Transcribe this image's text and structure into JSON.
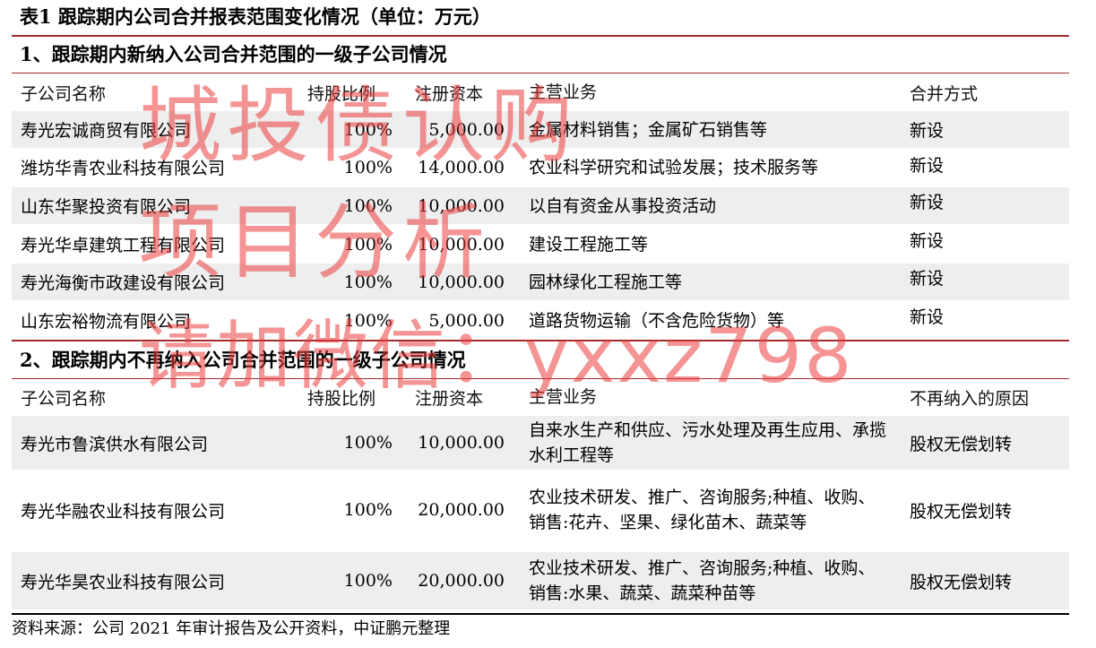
{
  "title": "表1  跟踪期内公司合并报表范围变化情况（单位：万元）",
  "section1": {
    "title": "1、跟踪期内新纳入公司合并范围的一级子公司情况",
    "headers": [
      "子公司名称",
      "持股比例",
      "注册资本",
      "主营业务",
      "合并方式"
    ],
    "rows": [
      [
        "寿光宏诚商贸有限公司",
        "100%",
        "5,000.00",
        "金属材料销售；金属矿石销售等",
        "新设"
      ],
      [
        "潍坊华青农业科技有限公司",
        "100%",
        "14,000.00",
        "农业科学研究和试验发展；技术服务等",
        "新设"
      ],
      [
        "山东华聚投资有限公司",
        "100%",
        "10,000.00",
        "以自有资金从事投资活动",
        "新设"
      ],
      [
        "寿光华卓建筑工程有限公司",
        "100%",
        "10,000.00",
        "建设工程施工等",
        "新设"
      ],
      [
        "寿光海衡市政建设有限公司",
        "100%",
        "10,000.00",
        "园林绿化工程施工等",
        "新设"
      ],
      [
        "山东宏裕物流有限公司",
        "100%",
        "5,000.00",
        "道路货物运输（不含危险货物）等",
        "新设"
      ]
    ]
  },
  "section2": {
    "title": "2、跟踪期内不再纳入公司合并范围的一级子公司情况",
    "headers": [
      "子公司名称",
      "持股比例",
      "注册资本",
      "主营业务",
      "不再纳入的原因"
    ],
    "rows": [
      [
        "寿光市鲁滨供水有限公司",
        "100%",
        "10,000.00",
        "自来水生产和供应、污水处理及再生应用、承揽水利工程等",
        "股权无偿划转"
      ],
      [
        "寿光华融农业科技有限公司",
        "100%",
        "20,000.00",
        "农业技术研发、推广、咨询服务;种植、收购、销售:花卉、坚果、绿化苗木、蔬菜等",
        "股权无偿划转"
      ],
      [
        "寿光华昊农业科技有限公司",
        "100%",
        "20,000.00",
        "农业技术研发、推广、咨询服务;种植、收购、销售:水果、蔬菜、蔬菜种苗等",
        "股权无偿划转"
      ]
    ]
  },
  "source": "资料来源：公司 2021 年审计报告及公开资料，中证鹏元整理",
  "watermark": {
    "line1": "城投债认购",
    "line2": "项目分析",
    "line3": "请加微信：yxxz798",
    "color": "#eb3c3c"
  }
}
